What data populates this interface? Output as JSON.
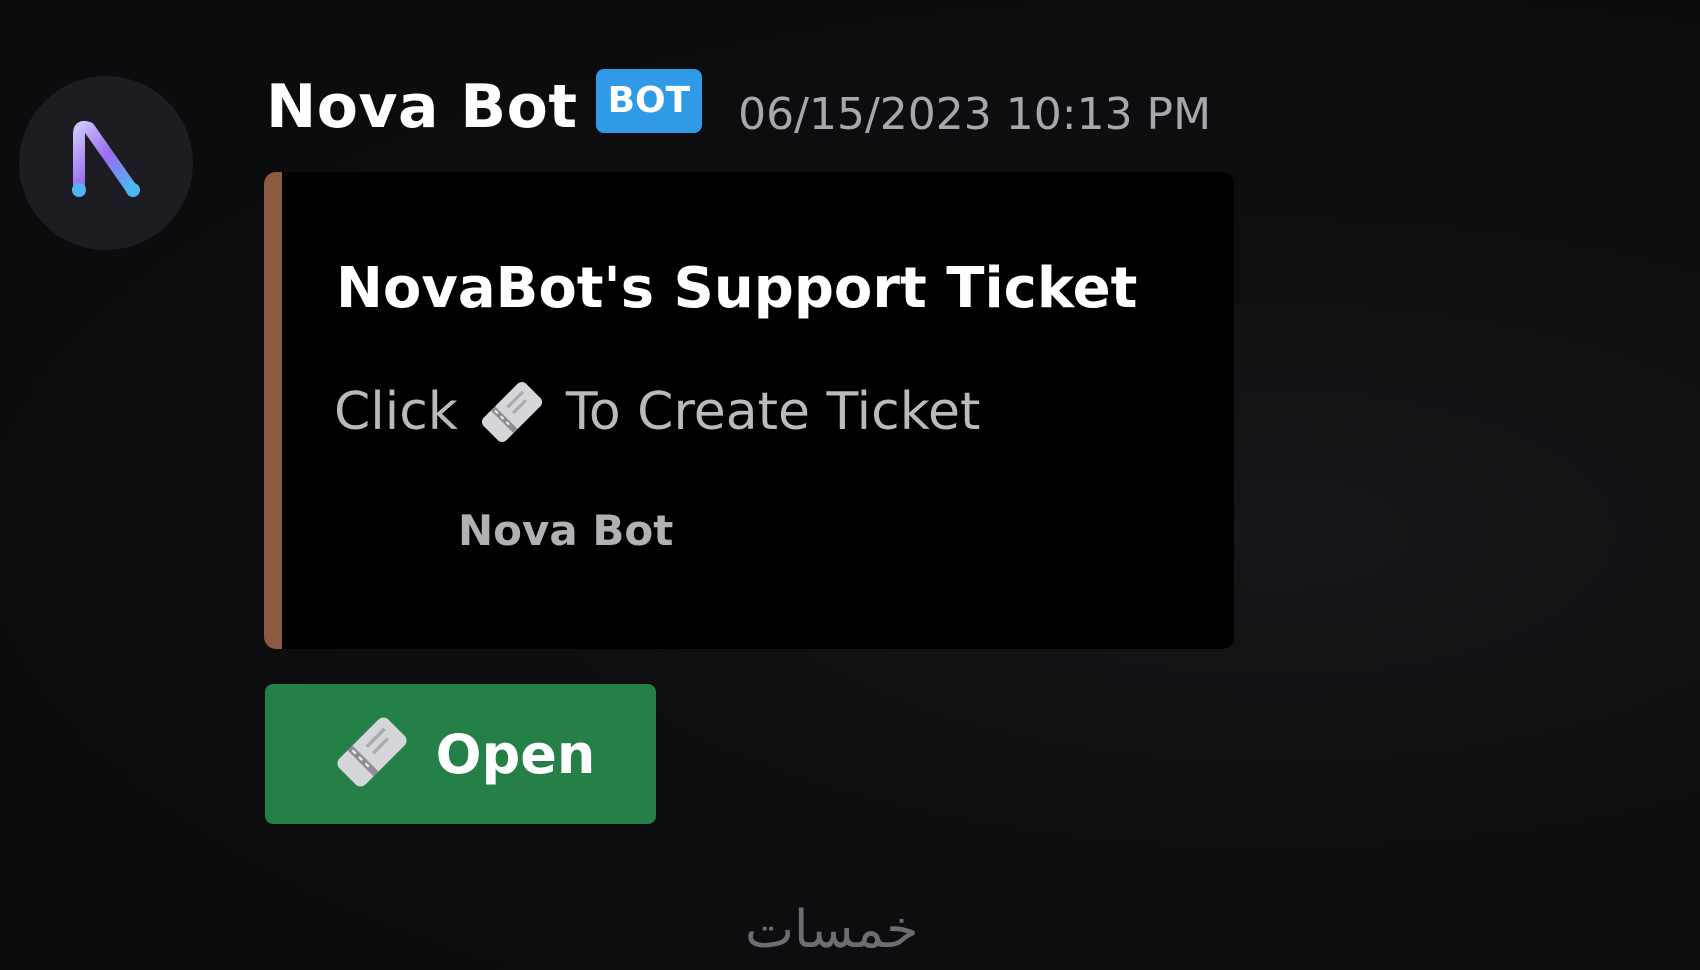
{
  "message": {
    "author": {
      "name": "Nova Bot",
      "badge": "BOT",
      "timestamp": "06/15/2023 10:13 PM",
      "avatar_icon": "nova-n-logo-icon"
    },
    "embed": {
      "accent_color": "#8a5a43",
      "title": "NovaBot's Support Ticket",
      "description_prefix": "Click",
      "description_icon": "ticket-icon",
      "description_suffix": "To Create Ticket",
      "footer_text": "Nova Bot"
    },
    "button": {
      "label": "Open",
      "icon": "ticket-icon",
      "color": "#248046"
    }
  },
  "watermark": {
    "text": "خمسات"
  },
  "colors": {
    "badge": "#2f9be6",
    "background": "#0c0c0e"
  }
}
